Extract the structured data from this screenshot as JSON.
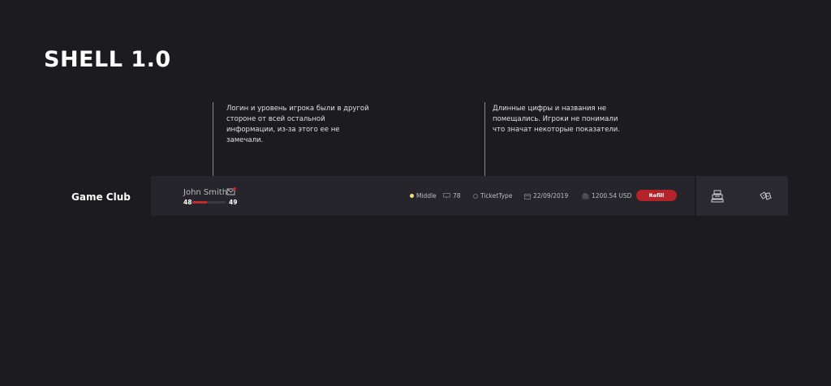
{
  "title": "SHELL 1.0",
  "notes": {
    "left": "Логин и уровень игрока были в другой стороне от всей остальной информации, из-за этого ее не замечали.",
    "right": "Длинные цифры и названия не помещались. Игроки не понимали что значат некоторые показатели."
  },
  "club": {
    "name": "Game Club"
  },
  "player": {
    "name": "John Smith",
    "level_current": "48",
    "level_next": "49",
    "level_progress": 0.45
  },
  "stats": {
    "rank": "Middle",
    "pcs": "78",
    "ticket": "TicketType",
    "date": "22/09/2019",
    "balance": "1200.54 USD"
  },
  "refill_label": "Refill",
  "icons": {
    "mail": "mail-icon",
    "rank": "rank-dot-icon",
    "pc": "monitor-icon",
    "ticket": "ticket-icon",
    "date": "calendar-icon",
    "wallet": "wallet-icon",
    "panel_1": "cash-register-icon",
    "panel_2": "dice-icon"
  },
  "colors": {
    "background": "#1c1b20",
    "bar": "#26252b",
    "accent": "#b4232a",
    "rank_dot": "#f2e27a"
  }
}
